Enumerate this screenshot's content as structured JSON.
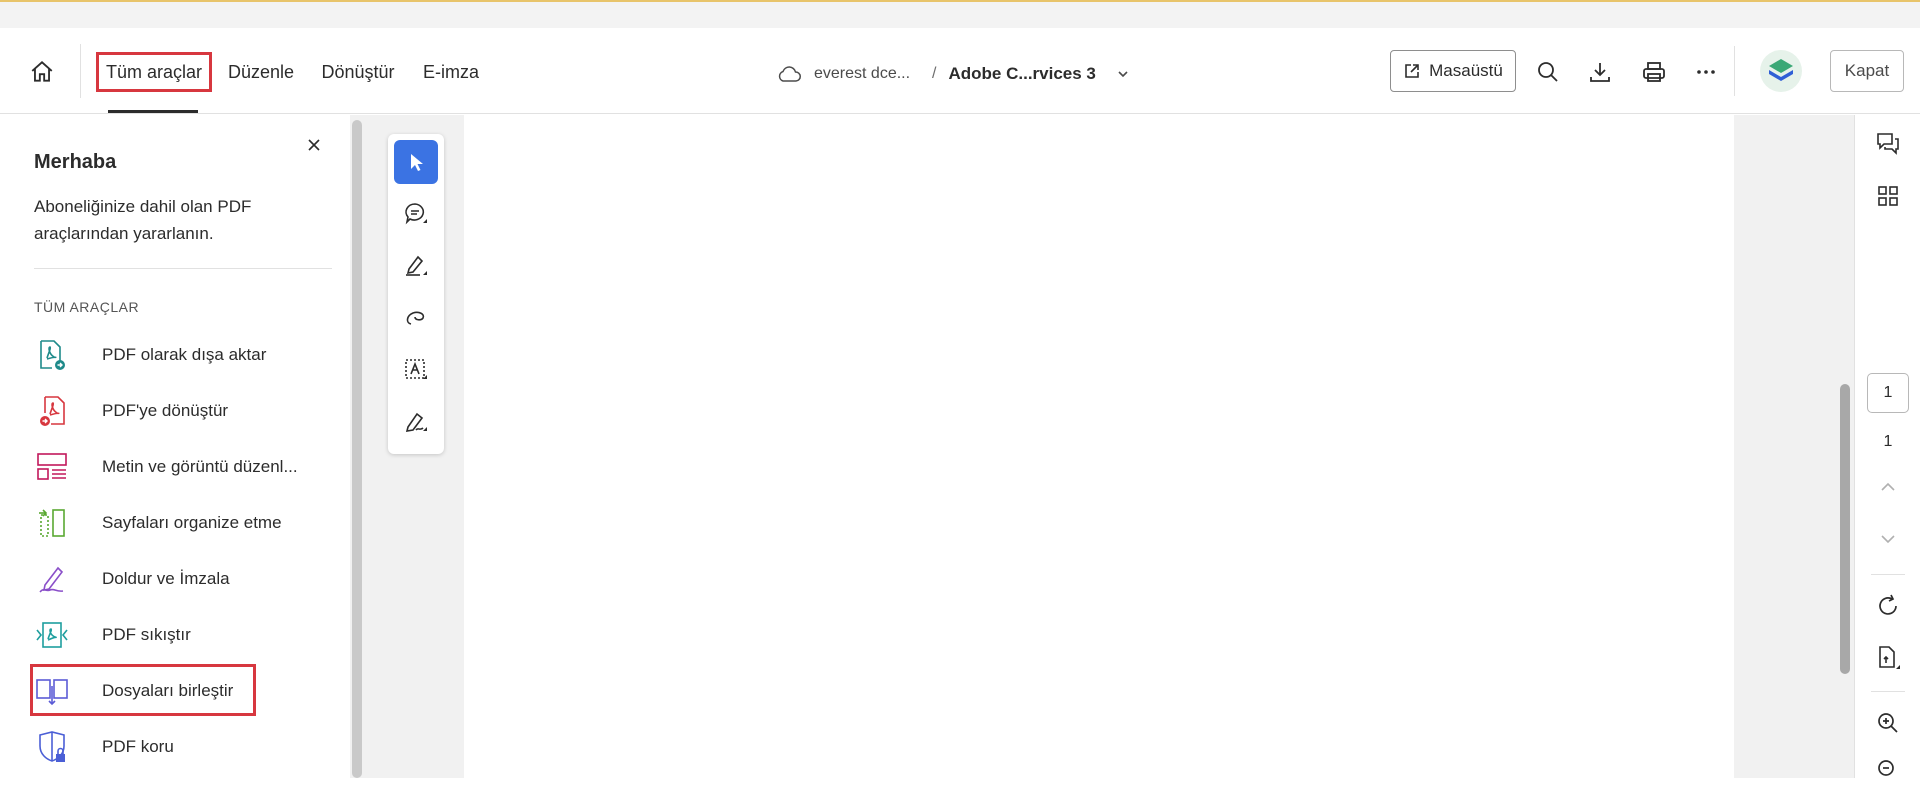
{
  "toolbar": {
    "tabs": [
      {
        "label": "Tüm araçlar"
      },
      {
        "label": "Düzenle"
      },
      {
        "label": "Dönüştür"
      },
      {
        "label": "E-imza"
      }
    ],
    "breadcrumb": {
      "folder": "everest dce...",
      "separator": "/",
      "file": "Adobe C...rvices 3"
    },
    "desktop_label": "Masaüstü",
    "close_label": "Kapat"
  },
  "left_panel": {
    "title": "Merhaba",
    "description": "Aboneliğinize dahil olan PDF araçlarından yararlanın.",
    "section": "TÜM ARAÇLAR",
    "tools": [
      {
        "label": "PDF olarak dışa aktar",
        "icon": "export-pdf-icon",
        "color": "#1e8a8a"
      },
      {
        "label": "PDF'ye dönüştür",
        "icon": "create-pdf-icon",
        "color": "#d7373f"
      },
      {
        "label": "Metin ve görüntü düzenl...",
        "icon": "edit-pdf-icon",
        "color": "#c2185b"
      },
      {
        "label": "Sayfaları organize etme",
        "icon": "organize-pages-icon",
        "color": "#5aa832"
      },
      {
        "label": "Doldur ve İmzala",
        "icon": "fill-sign-icon",
        "color": "#8a4fc9"
      },
      {
        "label": "PDF sıkıştır",
        "icon": "compress-pdf-icon",
        "color": "#1e9e9e"
      },
      {
        "label": "Dosyaları birleştir",
        "icon": "combine-files-icon",
        "color": "#5b5bd6"
      },
      {
        "label": "PDF koru",
        "icon": "protect-pdf-icon",
        "color": "#4b5fd6"
      }
    ]
  },
  "quick_tools": [
    "select-tool-icon",
    "comment-tool-icon",
    "highlight-tool-icon",
    "draw-tool-icon",
    "text-select-tool-icon",
    "sign-tool-icon"
  ],
  "right_rail": {
    "current_page": "1",
    "total_pages": "1"
  },
  "colors": {
    "accent": "#3b73e3",
    "highlight_box": "#d7373f"
  }
}
